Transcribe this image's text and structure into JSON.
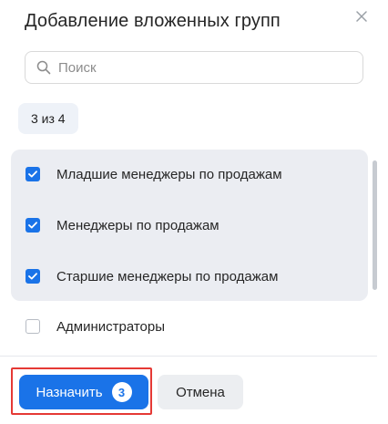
{
  "dialog": {
    "title": "Добавление вложенных групп",
    "close_icon": "close-icon"
  },
  "search": {
    "placeholder": "Поиск",
    "value": "",
    "icon": "search-icon"
  },
  "counter": "3 из 4",
  "groups": [
    {
      "label": "Младшие менеджеры по продажам",
      "checked": true
    },
    {
      "label": "Менеджеры по продажам",
      "checked": true
    },
    {
      "label": "Старшие менеджеры по продажам",
      "checked": true
    },
    {
      "label": "Администраторы",
      "checked": false
    }
  ],
  "footer": {
    "assign_label": "Назначить",
    "assign_count": "3",
    "cancel_label": "Отмена"
  },
  "colors": {
    "accent": "#1a73e8",
    "selected_bg": "#ebedf2",
    "highlight": "#e53935"
  }
}
